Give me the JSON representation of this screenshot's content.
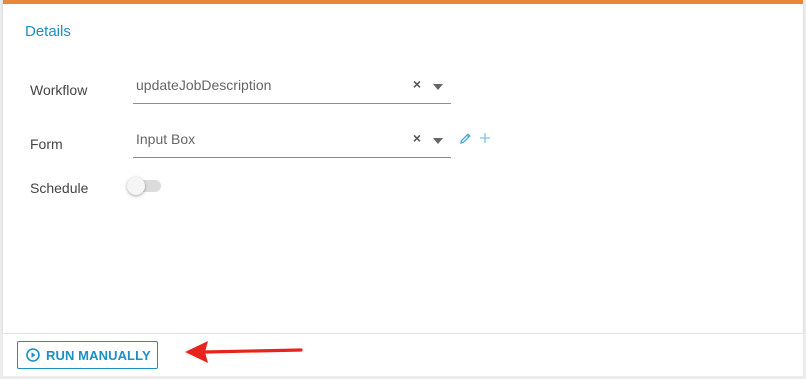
{
  "details": {
    "title": "Details",
    "accent_color": "#e8873a",
    "link_color": "#1a90c6"
  },
  "workflow": {
    "label": "Workflow",
    "value": "updateJobDescription",
    "clear_glyph": "×"
  },
  "form": {
    "label": "Form",
    "value": "Input Box",
    "clear_glyph": "×",
    "edit_icon": "pencil-icon",
    "add_icon": "plus-icon"
  },
  "schedule": {
    "label": "Schedule",
    "enabled": false
  },
  "footer": {
    "run_label": "RUN MANUALLY",
    "run_icon": "play-circle-icon",
    "annotation": "red-arrow-pointing-left",
    "annotation_color": "#e8231c"
  }
}
